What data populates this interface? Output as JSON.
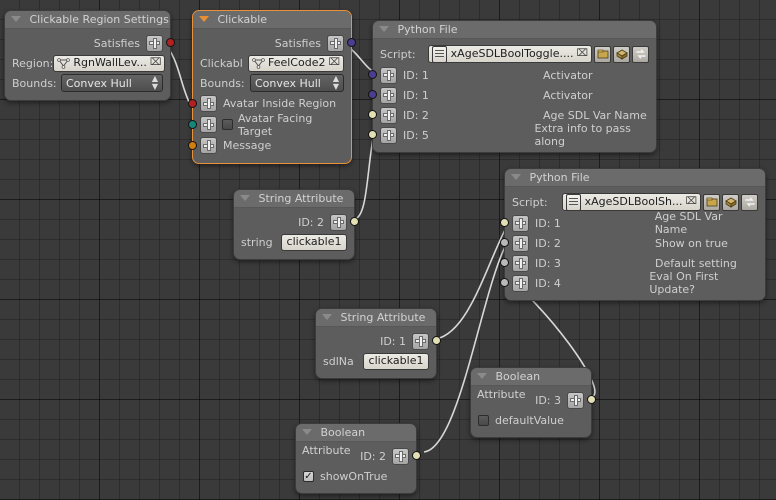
{
  "editor": {
    "name": "node-editor",
    "background": "#3a3a3a",
    "grid": "#2d2d2d",
    "select_color": "#e8903a"
  },
  "nodes": [
    {
      "id": "clickable-region-settings",
      "title": "Clickable Region Settings",
      "selected": false,
      "output_label": "Satisfies",
      "fields": [
        {
          "label": "Region:",
          "type": "picker",
          "value": "RgnWallLev...",
          "icon": "region-icon",
          "clear": "⌧"
        },
        {
          "label": "Bounds:",
          "type": "dropdown",
          "value": "Convex Hull"
        }
      ]
    },
    {
      "id": "clickable",
      "title": "Clickable",
      "selected": true,
      "output_label": "Satisfies",
      "fields": [
        {
          "label": "Clickabl",
          "type": "picker",
          "value": "FeelCode2",
          "icon": "object-icon",
          "clear": "⌧"
        },
        {
          "label": "Bounds:",
          "type": "dropdown",
          "value": "Convex Hull"
        }
      ],
      "inputs": [
        {
          "label": "Avatar Inside Region",
          "color": "red",
          "checkbox": null
        },
        {
          "label": "Avatar Facing Target",
          "color": "teal",
          "checkbox": false
        },
        {
          "label": "Message",
          "color": "orange",
          "checkbox": null
        }
      ]
    },
    {
      "id": "python-file-toggle",
      "title": "Python File",
      "selected": false,
      "script_label": "Script:",
      "script_value": "xAgeSDLBoolToggle....",
      "script_clear": "⌧",
      "script_buttons": [
        "save-icon",
        "package-icon",
        "refresh-icon"
      ],
      "inputs": [
        {
          "id": "ID: 1",
          "label": "Activator",
          "color": "purple"
        },
        {
          "id": "ID: 1",
          "label": "Activator",
          "color": "purple"
        },
        {
          "id": "ID: 2",
          "label": "Age SDL Var Name",
          "color": "cream"
        },
        {
          "id": "ID: 5",
          "label": "Extra info to pass along",
          "color": "cream"
        }
      ]
    },
    {
      "id": "python-file-show",
      "title": "Python File",
      "selected": false,
      "script_label": "Script:",
      "script_value": "xAgeSDLBoolSh...",
      "script_clear": "⌧",
      "script_buttons": [
        "save-icon",
        "package-icon",
        "refresh-icon"
      ],
      "inputs": [
        {
          "id": "ID: 1",
          "label": "Age SDL Var Name",
          "color": "cream"
        },
        {
          "id": "ID: 2",
          "label": "Show on true",
          "color": "gray"
        },
        {
          "id": "ID: 3",
          "label": "Default setting",
          "color": "gray"
        },
        {
          "id": "ID: 4",
          "label": "Eval On First Update?",
          "color": "gray"
        }
      ]
    },
    {
      "id": "string-attribute-2",
      "title": "String Attribute",
      "selected": false,
      "out_id": "ID: 2",
      "prop_label": "string",
      "prop_value": "clickable1"
    },
    {
      "id": "string-attribute-1",
      "title": "String Attribute",
      "selected": false,
      "out_id": "ID: 1",
      "prop_label": "sdlNa",
      "prop_value": "clickable1"
    },
    {
      "id": "boolean-attribute-3",
      "title": "Boolean Attribute",
      "selected": false,
      "out_id": "ID: 3",
      "prop_label": "defaultValue",
      "checked": false
    },
    {
      "id": "boolean-attribute-2",
      "title": "Boolean Attribute",
      "selected": false,
      "out_id": "ID: 2",
      "prop_label": "showOnTrue",
      "checked": true
    }
  ]
}
